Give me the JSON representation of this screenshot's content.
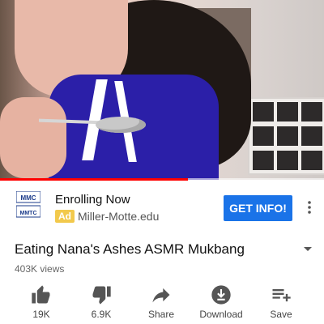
{
  "video": {
    "progress": 0.58
  },
  "ad": {
    "logo_text": [
      "MMC",
      "MMTC"
    ],
    "title": "Enrolling Now",
    "badge": "Ad",
    "url": "Miller-Motte.edu",
    "cta": "GET INFO!",
    "menu_icon": "kebab-icon"
  },
  "video_info": {
    "title": "Eating Nana's Ashes ASMR Mukbang",
    "views": "403K views",
    "expand_icon": "chevron-down-icon"
  },
  "actions": [
    {
      "icon": "thumbs-up-icon",
      "label": "19K"
    },
    {
      "icon": "thumbs-down-icon",
      "label": "6.9K"
    },
    {
      "icon": "share-icon",
      "label": "Share"
    },
    {
      "icon": "download-icon",
      "label": "Download"
    },
    {
      "icon": "save-playlist-icon",
      "label": "Save"
    }
  ]
}
